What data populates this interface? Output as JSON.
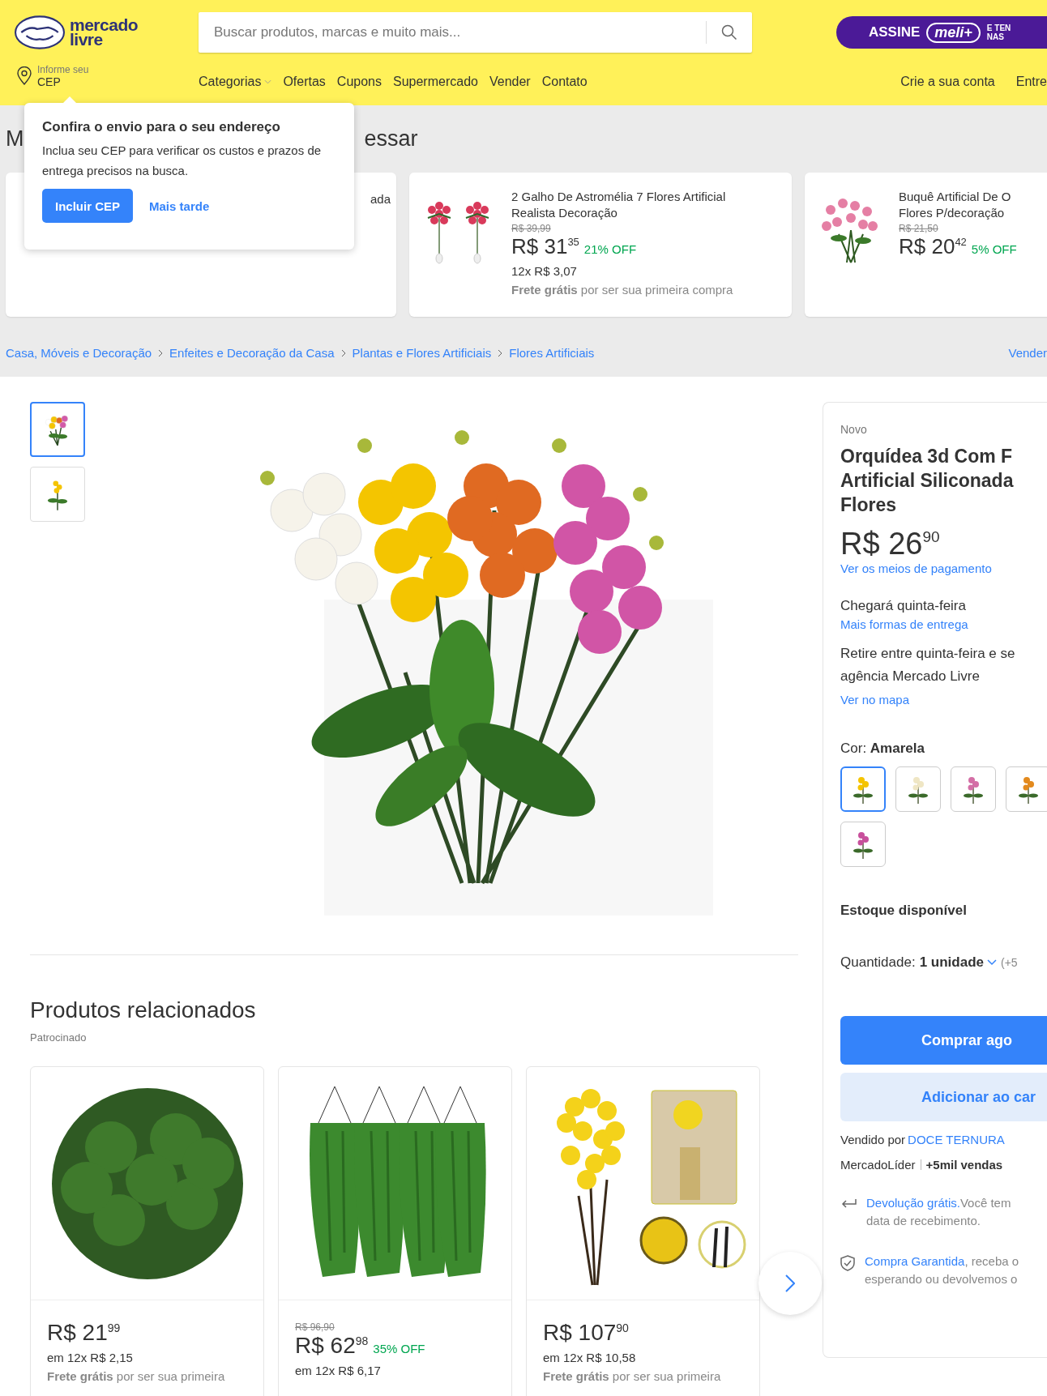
{
  "header": {
    "logo_lines": [
      "mercado",
      "livre"
    ],
    "search": {
      "placeholder": "Buscar produtos, marcas e muito mais..."
    },
    "subscription": {
      "label": "ASSINE",
      "brand": "meli+",
      "note_lines": [
        "E TEN",
        "NAS"
      ]
    },
    "location": {
      "label": "Informe seu",
      "value": "CEP"
    },
    "nav": [
      {
        "label": "Categorias",
        "kind": "dropdown"
      },
      {
        "label": "Ofertas",
        "kind": "link"
      },
      {
        "label": "Cupons",
        "kind": "link"
      },
      {
        "label": "Supermercado",
        "kind": "link"
      },
      {
        "label": "Vender",
        "kind": "link"
      },
      {
        "label": "Contato",
        "kind": "link"
      }
    ],
    "account_links": [
      "Crie a sua conta",
      "Entre"
    ]
  },
  "cep_popup": {
    "title": "Confira o envio para o seu endereço",
    "text": "Inclua seu CEP para verificar os custos e prazos de entrega precisos na busca.",
    "primary_button": "Incluir CEP",
    "secondary_button": "Mais tarde"
  },
  "recent": {
    "heading_start": "M",
    "heading_end": "essar",
    "items": [
      {
        "kind": "flower-covered",
        "title_lines": [
          "ada"
        ]
      },
      {
        "kind": "pink-pair",
        "title_lines": [
          "2 Galho De Astromélia 7 Flores Artificial",
          "Realista Decoração"
        ],
        "old_price": "R$ 39,99",
        "price": "R$ 31",
        "cents": "35",
        "discount": "21% OFF",
        "installments": "12x R$ 3,07",
        "shipping": "**Frete grátis** por ser sua primeira compra"
      },
      {
        "kind": "pink-bouquet",
        "title_lines": [
          "Buquê Artificial De O",
          "Flores P/decoração"
        ],
        "old_price": "R$ 21,50",
        "price": "R$ 20",
        "cents": "42",
        "discount": "5% OFF"
      }
    ]
  },
  "breadcrumb": {
    "items": [
      "Casa, Móveis e Decoração",
      "Enfeites e Decoração da Casa",
      "Plantas e Flores Artificiais",
      "Flores Artificiais"
    ],
    "right_link": "Vender"
  },
  "product": {
    "thumbnails": [
      {
        "kind": "bouquet",
        "selected": true
      },
      {
        "kind": "single",
        "selected": false
      }
    ],
    "condition": "Novo",
    "title_lines": [
      "Orquídea 3d Com F",
      "Artificial Siliconada",
      "Flores"
    ],
    "price": "R$ 26",
    "cents": "90",
    "payment_link": "Ver os meios de pagamento",
    "delivery": "Chegará quinta-feira",
    "delivery_link": "Mais formas de entrega",
    "pickup_lines": [
      "Retire entre quinta-feira e se",
      "agência Mercado Livre"
    ],
    "map_link": "Ver no mapa",
    "color_label": "Cor:",
    "color_value": "Amarela",
    "swatches": [
      {
        "color": "#f5c400",
        "selected": true
      },
      {
        "color": "#efe6c4",
        "selected": false
      },
      {
        "color": "#d46fa6",
        "selected": false
      },
      {
        "color": "#e38a1e",
        "selected": false
      },
      {
        "color": "#c8509c",
        "selected": false
      }
    ],
    "stock": "Estoque disponível",
    "quantity_label": "Quantidade:",
    "quantity_value": "1 unidade",
    "quantity_note": "(+5",
    "buy_button": "Comprar ago",
    "cart_button": "Adicionar ao car",
    "seller_label": "Vendido por",
    "seller_name": "DOCE TERNURA",
    "seller_badge": "MercadoLíder",
    "seller_sales": "+5mil vendas",
    "benefits": [
      {
        "kind": "return",
        "link": "Devolução grátis.",
        "rest": "Você tem",
        "line2": "data de recebimento."
      },
      {
        "kind": "shield",
        "link": "Compra Garantida",
        "rest": ", receba o",
        "line2": "esperando ou devolvemos o"
      }
    ]
  },
  "related": {
    "heading": "Produtos relacionados",
    "sponsor": "Patrocinado",
    "products": [
      {
        "kind": "moss",
        "price": "R$ 21",
        "cents": "99",
        "installments": "em 12x R$ 2,15",
        "shipping": "**Frete grátis** por ser sua primeira"
      },
      {
        "kind": "ferns",
        "old_price": "R$ 96,90",
        "price": "R$ 62",
        "cents": "98",
        "discount": "35% OFF",
        "installments": "em 12x R$ 6,17"
      },
      {
        "kind": "yellow-branches",
        "price": "R$ 107",
        "cents": "90",
        "installments": "em 12x R$ 10,58",
        "shipping": "**Frete grátis** por ser sua primeira"
      }
    ]
  }
}
